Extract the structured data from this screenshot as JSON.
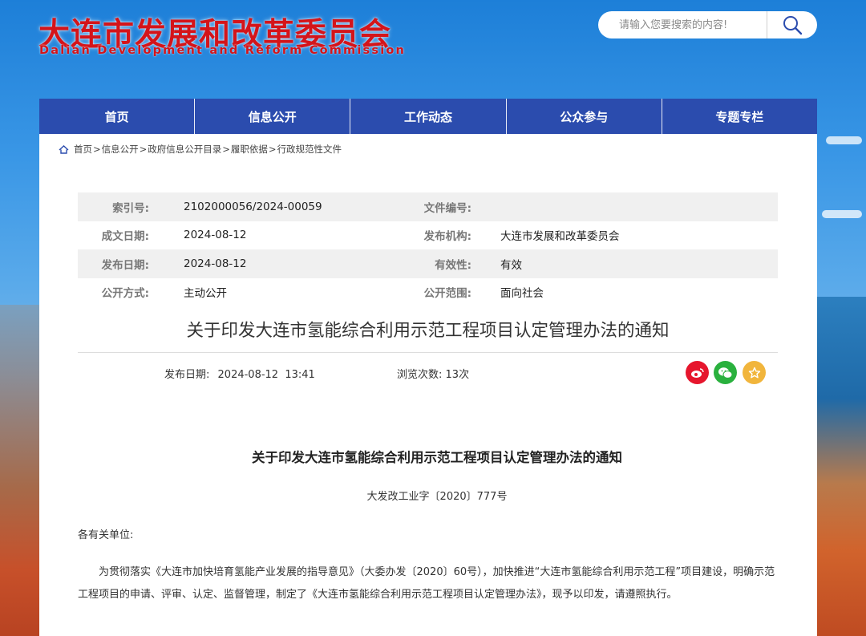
{
  "header": {
    "title": "大连市发展和改革委员会",
    "subtitle": "Dalian Development and Reform Commission"
  },
  "search": {
    "placeholder": "请输入您要搜索的内容!",
    "icon": "search-icon"
  },
  "nav": {
    "items": [
      {
        "label": "首页"
      },
      {
        "label": "信息公开"
      },
      {
        "label": "工作动态"
      },
      {
        "label": "公众参与"
      },
      {
        "label": "专题专栏"
      }
    ]
  },
  "breadcrumb": {
    "items": [
      {
        "label": "首页"
      },
      {
        "label": "信息公开"
      },
      {
        "label": "政府信息公开目录"
      },
      {
        "label": "履职依据"
      },
      {
        "label": "行政规范性文件"
      }
    ],
    "separator": ">"
  },
  "meta": {
    "rows": [
      {
        "label1": "索引号:",
        "value1": "2102000056/2024-00059",
        "label2": "文件编号:",
        "value2": ""
      },
      {
        "label1": "成文日期:",
        "value1": "2024-08-12",
        "label2": "发布机构:",
        "value2": "大连市发展和改革委员会"
      },
      {
        "label1": "发布日期:",
        "value1": "2024-08-12",
        "label2": "有效性:",
        "value2": "有效"
      },
      {
        "label1": "公开方式:",
        "value1": "主动公开",
        "label2": "公开范围:",
        "value2": "面向社会"
      }
    ]
  },
  "article": {
    "title": "关于印发大连市氢能综合利用示范工程项目认定管理办法的通知",
    "publish_label": "发布日期:",
    "publish_value": "2024-08-12  13:41",
    "views_label": "浏览次数:",
    "views_value": "13次",
    "body_title": "关于印发大连市氢能综合利用示范工程项目认定管理办法的通知",
    "doc_number": "大发改工业字〔2020〕777号",
    "salutation": "各有关单位:",
    "paragraph": "为贯彻落实《大连市加快培育氢能产业发展的指导意见》（大委办发〔2020〕60号），加快推进“大连市氢能综合利用示范工程”项目建设，明确示范工程项目的申请、评审、认定、监督管理，制定了《大连市氢能综合利用示范工程项目认定管理办法》，现予以印发，请遵照执行。"
  },
  "share": {
    "weibo_color": "#e6162d",
    "wechat_color": "#2ab13e",
    "favorite_color": "#f1b53c"
  }
}
